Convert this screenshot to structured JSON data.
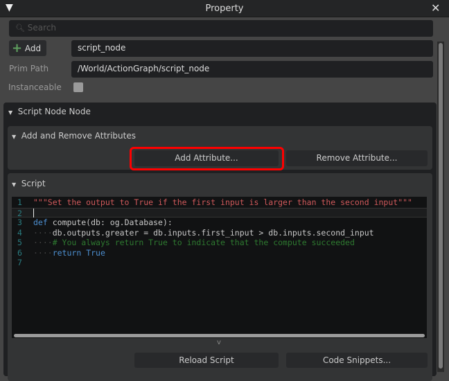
{
  "window": {
    "title": "Property"
  },
  "search": {
    "placeholder": "Search"
  },
  "add_button": "Add",
  "name_field": "script_node",
  "prim_path": {
    "label": "Prim Path",
    "value": "/World/ActionGraph/script_node"
  },
  "instanceable": {
    "label": "Instanceable",
    "checked": false
  },
  "node_section": {
    "title": "Script Node Node"
  },
  "attributes_section": {
    "title": "Add and Remove Attributes",
    "add_label": "Add Attribute...",
    "remove_label": "Remove Attribute..."
  },
  "script_section": {
    "title": "Script",
    "reload_label": "Reload Script",
    "snippets_label": "Code Snippets...",
    "expand_label": "v"
  },
  "code": {
    "line_numbers": [
      "1",
      "2",
      "3",
      "4",
      "5",
      "6",
      "7"
    ],
    "l1": "\"\"\"Set the output to True if the first input is larger than the second input\"\"\"",
    "l3_kw": "def",
    "l3": "compute(db: og.Database):",
    "l4": "db.outputs.greater = db.inputs.first_input > db.inputs.second_input",
    "l5": "# You always return True to indicate that the compute succeeded",
    "l6_kw": "return",
    "l6_val": "True",
    "indent": "····"
  },
  "colors": {
    "highlight": "#ff0000",
    "add_icon": "#5fa05f"
  }
}
